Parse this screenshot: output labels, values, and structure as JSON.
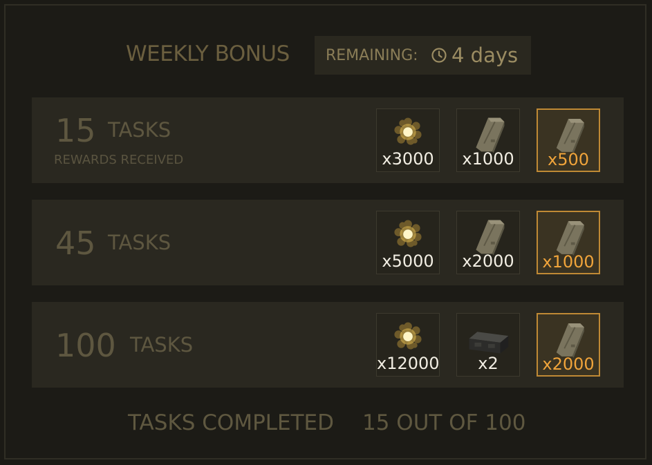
{
  "header": {
    "title": "WEEKLY BONUS",
    "remaining_label": "REMAINING:",
    "remaining_value": "4 days",
    "timer_icon": "clock-icon"
  },
  "tiers": [
    {
      "count": "15",
      "unit": "TASKS",
      "status": "REWARDS RECEIVED",
      "rewards": [
        {
          "icon": "energy-orb-icon",
          "qty": "x3000"
        },
        {
          "icon": "armor-plate-icon",
          "qty": "x1000"
        },
        {
          "icon": "armor-plate-icon",
          "qty": "x500",
          "highlight": true
        }
      ]
    },
    {
      "count": "45",
      "unit": "TASKS",
      "rewards": [
        {
          "icon": "energy-orb-icon",
          "qty": "x5000"
        },
        {
          "icon": "armor-plate-icon",
          "qty": "x2000"
        },
        {
          "icon": "armor-plate-icon",
          "qty": "x1000",
          "highlight": true
        }
      ]
    },
    {
      "count": "100",
      "unit": "TASKS",
      "rewards": [
        {
          "icon": "energy-orb-icon",
          "qty": "x12000"
        },
        {
          "icon": "ammo-crate-icon",
          "qty": "x2"
        },
        {
          "icon": "armor-plate-icon",
          "qty": "x2000",
          "highlight": true
        }
      ]
    }
  ],
  "footer": {
    "label": "TASKS COMPLETED",
    "value": "15 OUT OF 100"
  },
  "colors": {
    "highlight_border": "#c08a35",
    "highlight_text": "#f0a43b",
    "muted_text": "#5e5740"
  }
}
